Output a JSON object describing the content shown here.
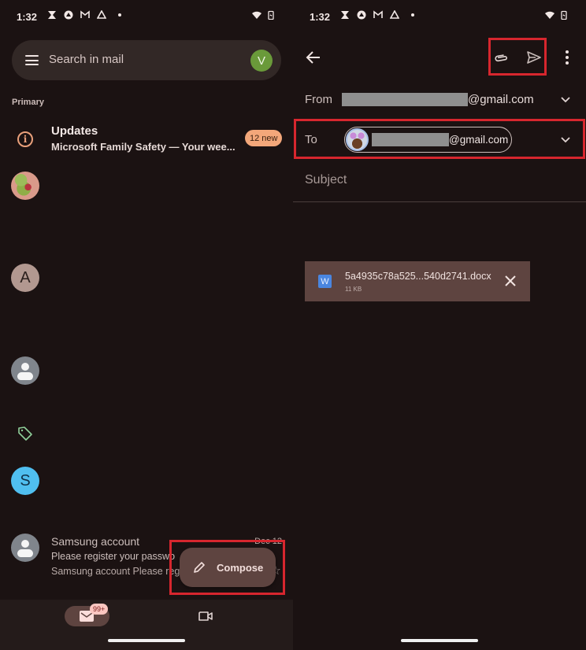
{
  "status_bar": {
    "time": "1:32",
    "left_icons": [
      "hourglass-icon",
      "app-icon",
      "gmail-icon",
      "drive-icon",
      "notification-dot"
    ],
    "right_icons": [
      "wifi-icon",
      "battery-charging-icon"
    ]
  },
  "inbox": {
    "search_placeholder": "Search in mail",
    "account_initial": "V",
    "account_color": "#6a9a3a",
    "section_label": "Primary",
    "updates": {
      "title": "Updates",
      "snippet": "Microsoft Family Safety — Your wee...",
      "badge": "12 new",
      "badge_color": "#f3a77a"
    },
    "avatars": [
      {
        "type": "photo"
      },
      {
        "type": "letter",
        "letter": "A",
        "color": "#b29890"
      },
      {
        "type": "person",
        "color": "#80858c"
      },
      {
        "type": "tag-icon"
      },
      {
        "type": "letter",
        "letter": "S",
        "color": "#50bff0"
      }
    ],
    "samsung_email": {
      "sender": "Samsung account",
      "subject": "Please register your passwo",
      "snippet": "Samsung account Please reg",
      "date": "Dec 12"
    },
    "compose_label": "Compose",
    "bottom_nav": {
      "mail_badge": "99+",
      "items": [
        "mail-icon",
        "meet-icon"
      ]
    }
  },
  "compose": {
    "from_label": "From",
    "from_domain": "@gmail.com",
    "to_label": "To",
    "to_domain": "@gmail.com",
    "subject_placeholder": "Subject",
    "attachment": {
      "icon_letter": "W",
      "filename": "5a4935c78a525...540d2741.docx",
      "size": "11 KB"
    }
  },
  "highlight_color": "#d7262e"
}
